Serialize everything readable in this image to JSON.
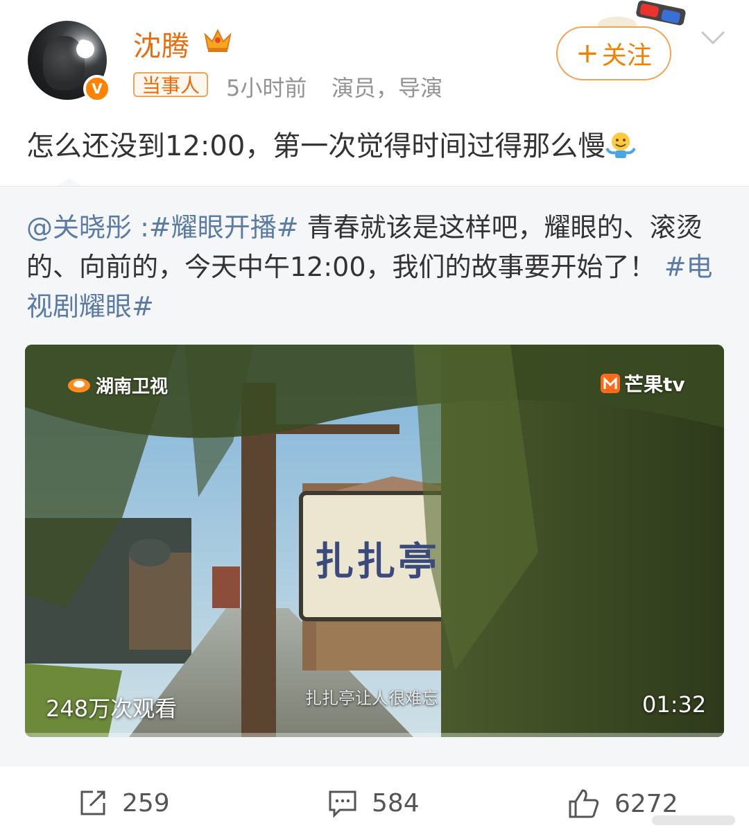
{
  "post": {
    "username": "沈腾",
    "tag": "当事人",
    "time": "5小时前",
    "role": "演员，导演",
    "follow_label": "关注",
    "text": "怎么还没到12:00，第一次觉得时间过得那么慢"
  },
  "repost": {
    "mention": "@关晓彤",
    "sep": " :",
    "hashtag1": "#耀眼开播#",
    "body": " 青春就该是这样吧，耀眼的、滚烫的、向前的，今天中午12:00，我们的故事要开始了！",
    "hashtag2": "#电视剧耀眼#"
  },
  "video": {
    "channel_left": "湖南卫视",
    "channel_right": "芒果tv",
    "views": "248万次观看",
    "subtitle": "扎扎亭让人很难忘",
    "duration": "01:32",
    "sign_text": "扎扎亭"
  },
  "actions": {
    "repost_count": "259",
    "comment_count": "584",
    "like_count": "6272"
  },
  "colors": {
    "accent": "#e86b0c",
    "link": "#5b7ba7",
    "verified": "#ff8200"
  },
  "icons": [
    "verified-v-icon",
    "crown-icon",
    "3d-glasses-icon",
    "chevron-down-icon",
    "smile-emoji-icon",
    "repost-icon",
    "comment-icon",
    "like-icon"
  ]
}
